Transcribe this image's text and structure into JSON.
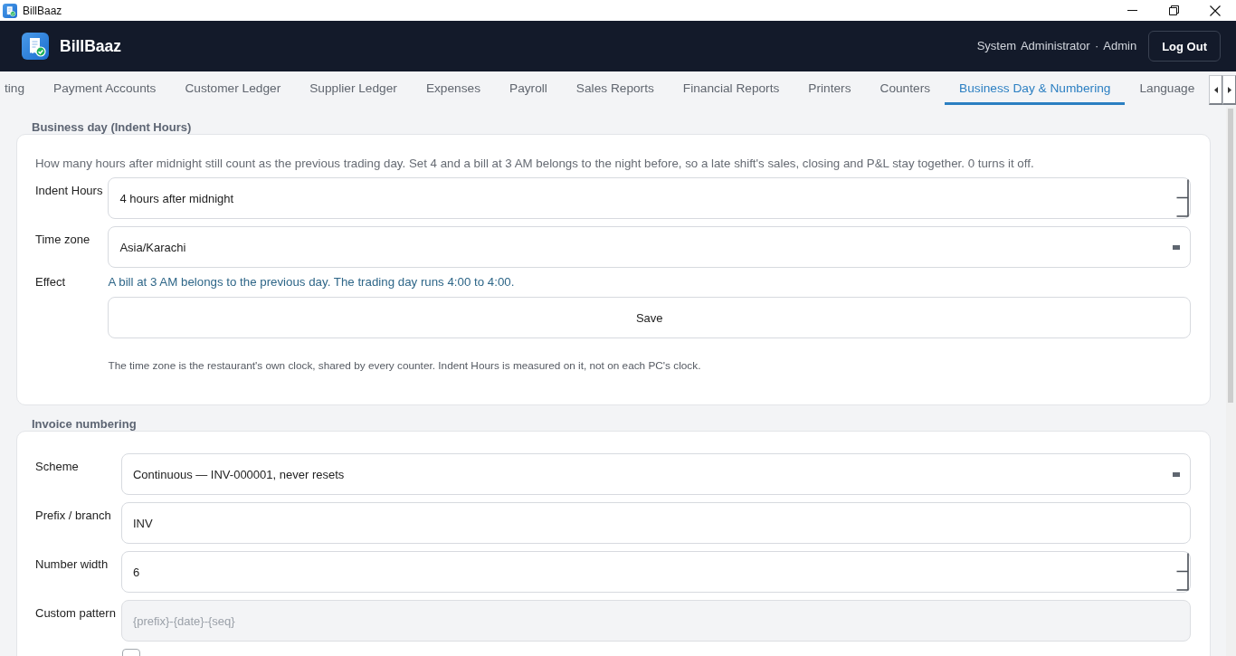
{
  "window": {
    "title": "BillBaaz"
  },
  "header": {
    "brand": "BillBaaz",
    "user_label": "System Administrator · Admin",
    "logout_button": "Log Out"
  },
  "tabs": [
    {
      "label": "ting",
      "selected": false
    },
    {
      "label": "Payment Accounts",
      "selected": false
    },
    {
      "label": "Customer Ledger",
      "selected": false
    },
    {
      "label": "Supplier Ledger",
      "selected": false
    },
    {
      "label": "Expenses",
      "selected": false
    },
    {
      "label": "Payroll",
      "selected": false
    },
    {
      "label": "Sales Reports",
      "selected": false
    },
    {
      "label": "Financial Reports",
      "selected": false
    },
    {
      "label": "Printers",
      "selected": false
    },
    {
      "label": "Counters",
      "selected": false
    },
    {
      "label": "Business Day & Numbering",
      "selected": true
    },
    {
      "label": "Language",
      "selected": false
    }
  ],
  "sections": [
    {
      "title": "Business day (Indent Hours)",
      "description": "How many hours after midnight still count as the previous trading day. Set 4 and a bill at 3 AM belongs to the night before, so a late shift's sales, closing and P&L stay together. 0 turns it off.",
      "fields": [
        {
          "kind": "spin",
          "label": "Indent Hours",
          "value": "4 hours after midnight",
          "disabled": false
        },
        {
          "kind": "select",
          "label": "Time zone",
          "value": "Asia/Karachi",
          "disabled": false
        },
        {
          "kind": "info",
          "label": "Effect",
          "value": "A bill at 3 AM belongs to the previous day. The trading day runs 4:00 to 4:00."
        }
      ],
      "button": "Save",
      "note": "The time zone is the restaurant's own clock, shared by every counter. Indent Hours is measured on it, not on each PC's clock."
    },
    {
      "title": "Invoice numbering",
      "fields": [
        {
          "kind": "select",
          "label": "Scheme",
          "value": "Continuous — INV-000001, never resets",
          "disabled": false
        },
        {
          "kind": "text",
          "label": "Prefix / branch",
          "value": "INV",
          "disabled": false
        },
        {
          "kind": "spin",
          "label": "Number width",
          "value": "6",
          "disabled": false
        },
        {
          "kind": "text",
          "label": "Custom pattern",
          "placeholder": "{prefix}-{date}-{seq}",
          "disabled": true
        },
        {
          "kind": "checkbox",
          "checked": false
        }
      ]
    }
  ]
}
